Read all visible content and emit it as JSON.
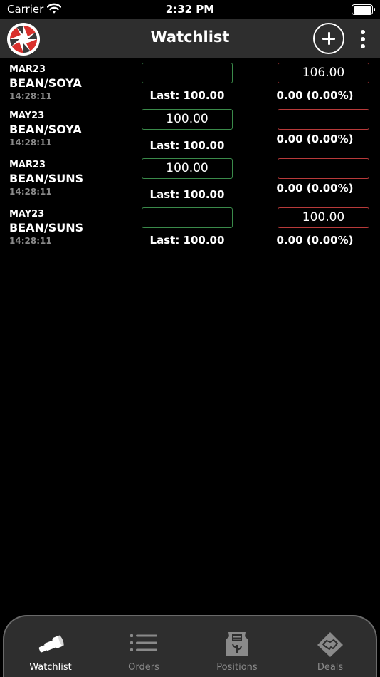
{
  "status_bar": {
    "carrier": "Carrier",
    "time": "2:32 PM"
  },
  "header": {
    "title": "Watchlist"
  },
  "rows": [
    {
      "month": "MAR23",
      "symbol": "BEAN/SOYA",
      "time": "14:28:11",
      "bid": "",
      "ask": "106.00",
      "last": "Last: 100.00",
      "change": "0.00 (0.00%)"
    },
    {
      "month": "MAY23",
      "symbol": "BEAN/SOYA",
      "time": "14:28:11",
      "bid": "100.00",
      "ask": "",
      "last": "Last: 100.00",
      "change": "0.00 (0.00%)"
    },
    {
      "month": "MAR23",
      "symbol": "BEAN/SUNS",
      "time": "14:28:11",
      "bid": "100.00",
      "ask": "",
      "last": "Last: 100.00",
      "change": "0.00 (0.00%)"
    },
    {
      "month": "MAY23",
      "symbol": "BEAN/SUNS",
      "time": "14:28:11",
      "bid": "",
      "ask": "100.00",
      "last": "Last: 100.00",
      "change": "0.00 (0.00%)"
    }
  ],
  "tabs": [
    {
      "label": "Watchlist",
      "icon": "telescope-icon",
      "active": true
    },
    {
      "label": "Orders",
      "icon": "list-icon",
      "active": false
    },
    {
      "label": "Positions",
      "icon": "sack-icon",
      "active": false
    },
    {
      "label": "Deals",
      "icon": "handshake-icon",
      "active": false
    }
  ],
  "colors": {
    "bid_border": "#3a8a4a",
    "ask_border": "#b83a3a",
    "header_bg": "#2e2e2e",
    "logo_red": "#d9302c"
  }
}
